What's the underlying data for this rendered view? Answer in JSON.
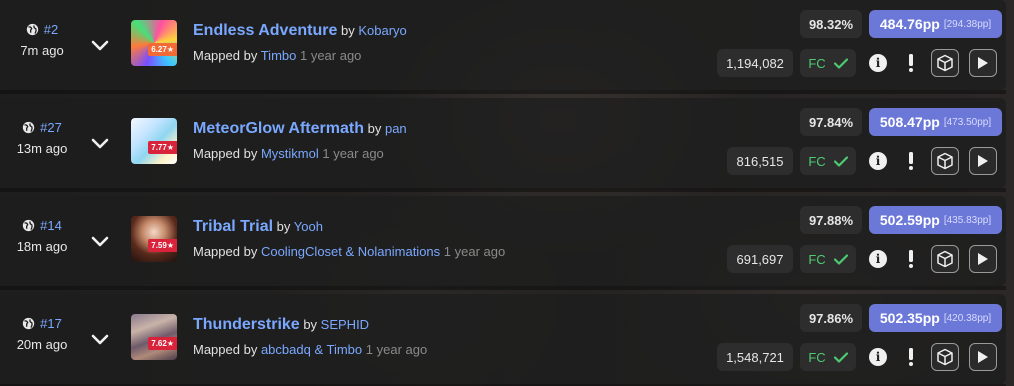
{
  "colors": {
    "link": "#7aa8ff",
    "pp": "#6c78d8",
    "fc": "#4ecb71",
    "star_red": "#d8233a",
    "star_orange": "#f26a36"
  },
  "icons": {
    "globe": "globe-icon",
    "expand": "chevron-down-icon",
    "fc": "check-icon",
    "info": "info-icon",
    "warning": "exclamation-icon",
    "replay_3d": "cube-icon",
    "play": "play-icon"
  },
  "scores": [
    {
      "rank": "#2",
      "ago": "7m ago",
      "stars": "6.27★",
      "star_style": "orange",
      "song": "Endless Adventure",
      "by": "by",
      "artist": "Kobaryo",
      "mapped_by": "Mapped by",
      "mapper": "Timbo",
      "mapped_time": "1 year ago",
      "accuracy": "98.32%",
      "pp": "484.76pp",
      "raw_pp": "[294.38pp]",
      "score": "1,194,082",
      "fc": "FC"
    },
    {
      "rank": "#27",
      "ago": "13m ago",
      "stars": "7.77★",
      "star_style": "red",
      "song": "MeteorGlow Aftermath",
      "by": "by",
      "artist": "pan",
      "mapped_by": "Mapped by",
      "mapper": "Mystikmol",
      "mapped_time": "1 year ago",
      "accuracy": "97.84%",
      "pp": "508.47pp",
      "raw_pp": "[473.50pp]",
      "score": "816,515",
      "fc": "FC"
    },
    {
      "rank": "#14",
      "ago": "18m ago",
      "stars": "7.59★",
      "star_style": "red",
      "song": "Tribal Trial",
      "by": "by",
      "artist": "Yooh",
      "mapped_by": "Mapped by",
      "mapper": "CoolingCloset & Nolanimations",
      "mapped_time": "1 year ago",
      "accuracy": "97.88%",
      "pp": "502.59pp",
      "raw_pp": "[435.83pp]",
      "score": "691,697",
      "fc": "FC"
    },
    {
      "rank": "#17",
      "ago": "20m ago",
      "stars": "7.62★",
      "star_style": "red",
      "song": "Thunderstrike",
      "by": "by",
      "artist": "SEPHID",
      "mapped_by": "Mapped by",
      "mapper": "abcbadq & Timbo",
      "mapped_time": "1 year ago",
      "accuracy": "97.86%",
      "pp": "502.35pp",
      "raw_pp": "[420.38pp]",
      "score": "1,548,721",
      "fc": "FC"
    }
  ]
}
